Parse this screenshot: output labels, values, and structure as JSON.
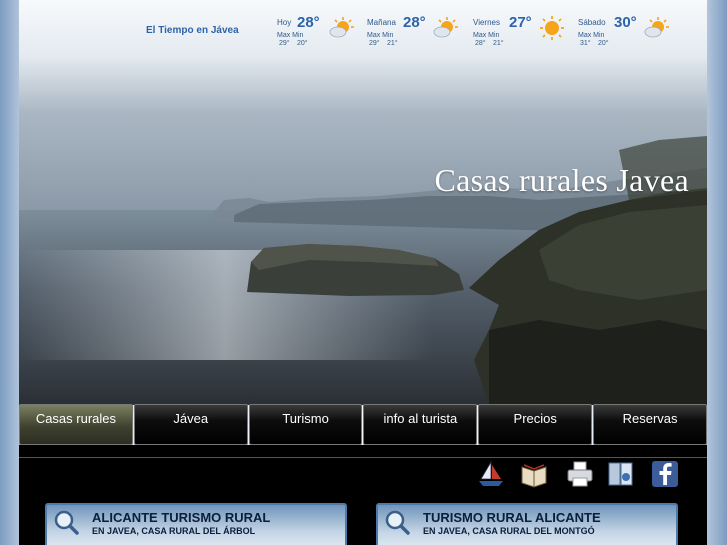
{
  "weather": {
    "title": "El Tiempo en Jávea",
    "labels": "Max  Min",
    "days": [
      {
        "name": "Hoy",
        "temp": "28°",
        "max": "29°",
        "min": "20°",
        "icon": "sun-cloud-icon"
      },
      {
        "name": "Mañana",
        "temp": "28°",
        "max": "29°",
        "min": "21°",
        "icon": "sun-cloud-icon"
      },
      {
        "name": "Viernes",
        "temp": "27°",
        "max": "28°",
        "min": "21°",
        "icon": "sun-icon"
      },
      {
        "name": "Sábado",
        "temp": "30°",
        "max": "31°",
        "min": "20°",
        "icon": "sun-cloud-icon"
      }
    ]
  },
  "hero": {
    "title": "Casas rurales Javea"
  },
  "nav": {
    "items": [
      "Casas rurales",
      "Jávea",
      "Turismo",
      "info al turista",
      "Precios",
      "Reservas"
    ],
    "active": "Casas rurales"
  },
  "tools": [
    "boat-icon",
    "book-icon",
    "printer-icon",
    "brochure-icon",
    "facebook-icon"
  ],
  "cards": [
    {
      "title": "ALICANTE TURISMO RURAL",
      "subtitle": "EN JAVEA, CASA RURAL DEL ÁRBOL"
    },
    {
      "title": "TURISMO RURAL ALICANTE",
      "subtitle": "EN JAVEA, CASA RURAL DEL MONTGÓ"
    }
  ],
  "colors": {
    "accent": "#2d63a8",
    "nav_bg": "#000000",
    "nav_active": "#4f533a",
    "card_border": "#4d7aa8"
  }
}
